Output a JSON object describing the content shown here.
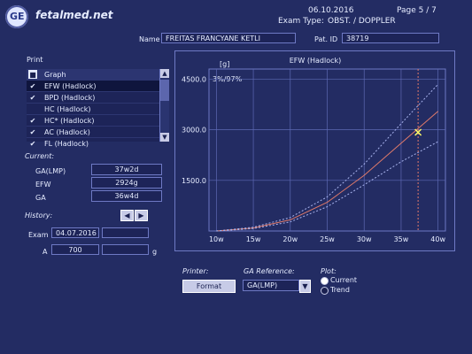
{
  "header": {
    "brand": "fetalmed.net",
    "date": "06.10.2016",
    "page": "Page  5 / 7",
    "exam_type_label": "Exam Type:",
    "exam_type_value": "OBST. / DOPPLER",
    "name_label": "Name",
    "name_value": "FREITAS FRANCYANE KETLI",
    "pat_id_label": "Pat. ID",
    "pat_id_value": "38719"
  },
  "print": {
    "title": "Print",
    "column_header": "Graph",
    "items": [
      {
        "label": "EFW (Hadlock)",
        "checked": true,
        "selected": true
      },
      {
        "label": "BPD (Hadlock)",
        "checked": true,
        "selected": false
      },
      {
        "label": "HC (Hadlock)",
        "checked": false,
        "selected": false
      },
      {
        "label": "HC* (Hadlock)",
        "checked": true,
        "selected": false
      },
      {
        "label": "AC (Hadlock)",
        "checked": true,
        "selected": false
      },
      {
        "label": "FL (Hadlock)",
        "checked": true,
        "selected": false
      }
    ]
  },
  "current": {
    "title": "Current:",
    "ga_lmp_label": "GA(LMP)",
    "ga_lmp_value": "37w2d",
    "efw_label": "EFW",
    "efw_value": "2924g",
    "ga_label": "GA",
    "ga_value": "36w4d"
  },
  "history": {
    "title": "History:",
    "exam_label": "Exam",
    "exam_value": "04.07.2016",
    "a_label": "A",
    "a_value": "700",
    "unit": "g"
  },
  "bottom": {
    "printer_label": "Printer:",
    "format_button": "Format",
    "ga_reference_label": "GA Reference:",
    "ga_reference_value": "GA(LMP)",
    "plot_label": "Plot:",
    "plot_current": "Current",
    "plot_trend": "Trend",
    "plot_selected": "Current"
  },
  "chart_data": {
    "type": "line",
    "title": "EFW (Hadlock)",
    "ylabel": "[g]",
    "xlabel": "",
    "percentile_label": "3%/97%",
    "xlim": [
      9,
      41
    ],
    "ylim": [
      0,
      4800
    ],
    "x_ticks": [
      10,
      15,
      20,
      25,
      30,
      35,
      40
    ],
    "x_tick_labels": [
      "10w",
      "15w",
      "20w",
      "25w",
      "30w",
      "35w",
      "40w"
    ],
    "y_ticks": [
      1500,
      3000,
      4500
    ],
    "y_tick_labels": [
      "1500.0",
      "3000.0",
      "4500.0"
    ],
    "grid": true,
    "series": [
      {
        "role": "p50",
        "style": "solid",
        "color": "#e07a6a",
        "x": [
          10,
          15,
          20,
          25,
          30,
          35,
          40
        ],
        "y": [
          0,
          90,
          330,
          850,
          1650,
          2600,
          3550
        ]
      },
      {
        "role": "p97",
        "style": "dashed",
        "color": "#a9b4ee",
        "x": [
          10,
          15,
          20,
          25,
          30,
          35,
          40
        ],
        "y": [
          0,
          110,
          400,
          1010,
          1980,
          3180,
          4350
        ]
      },
      {
        "role": "p3",
        "style": "dashed",
        "color": "#a9b4ee",
        "x": [
          10,
          15,
          20,
          25,
          30,
          35,
          40
        ],
        "y": [
          0,
          70,
          270,
          720,
          1370,
          2050,
          2650
        ]
      }
    ],
    "point": {
      "x": 37.3,
      "y": 2924,
      "marker": "x",
      "color": "#ffff66"
    },
    "vertical_marker": {
      "x": 37.3,
      "color": "#e07a6a"
    }
  },
  "colors": {
    "background": "#232c63",
    "border": "#6e79c4",
    "field_bg": "#1d2458",
    "median_line": "#e07a6a",
    "percentile_line": "#a9b4ee",
    "measurement_marker": "#ffff66"
  }
}
